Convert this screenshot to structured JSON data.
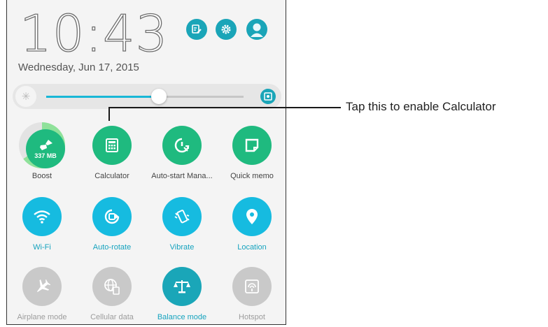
{
  "header": {
    "time": "10:43",
    "date": "Wednesday, Jun 17, 2015"
  },
  "header_buttons": [
    {
      "icon": "edit-icon",
      "x_note": "edit"
    },
    {
      "icon": "gear-icon"
    },
    {
      "icon": "user-icon"
    }
  ],
  "brightness": {
    "level": 0.57,
    "auto_icon": "auto-brightness-icon"
  },
  "tiles": [
    {
      "label": "Boost",
      "sub": "337 MB",
      "color": "green",
      "state": "on"
    },
    {
      "label": "Calculator",
      "color": "green",
      "state": "on"
    },
    {
      "label": "Auto-start Mana...",
      "color": "green",
      "state": "on"
    },
    {
      "label": "Quick memo",
      "color": "green",
      "state": "on"
    },
    {
      "label": "Wi-Fi",
      "color": "blue",
      "state": "on"
    },
    {
      "label": "Auto-rotate",
      "color": "blue",
      "state": "on"
    },
    {
      "label": "Vibrate",
      "color": "blue",
      "state": "on"
    },
    {
      "label": "Location",
      "color": "blue",
      "state": "on"
    },
    {
      "label": "Airplane mode",
      "color": "gray",
      "state": "off"
    },
    {
      "label": "Cellular data",
      "color": "gray",
      "state": "off"
    },
    {
      "label": "Balance mode",
      "color": "teal",
      "state": "on"
    },
    {
      "label": "Hotspot",
      "color": "gray",
      "state": "off"
    }
  ],
  "callout": {
    "text": "Tap this to enable Calculator"
  }
}
